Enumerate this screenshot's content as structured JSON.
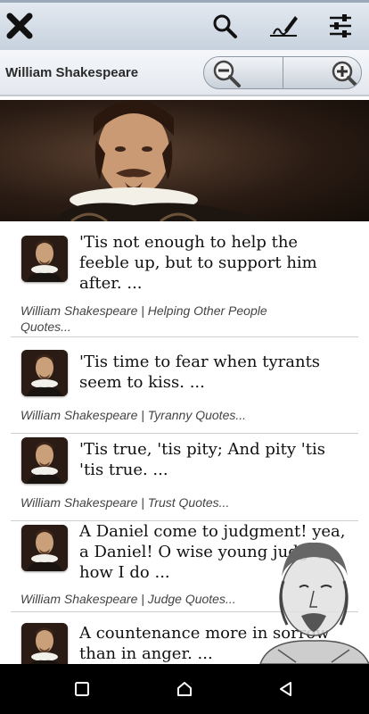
{
  "header": {
    "title": "William Shakespeare",
    "icons": [
      "close-icon",
      "search-icon",
      "sign-pen-icon",
      "settings-sliders-icon"
    ],
    "zoom": [
      "zoom-out-icon",
      "zoom-in-icon"
    ]
  },
  "banner": {
    "description_icon": "portrait-image"
  },
  "quotes": [
    {
      "text": "'Tis not enough to help the feeble up, but to support him after. ...",
      "source": "William Shakespeare | Helping Other People Quotes..."
    },
    {
      "text": "'Tis time to fear when tyrants seem to kiss. ...",
      "source": "William Shakespeare | Tyranny Quotes..."
    },
    {
      "text": "'Tis true, 'tis pity; And pity 'tis 'tis true. ...",
      "source": "William Shakespeare | Trust Quotes..."
    },
    {
      "text": "A Daniel come to judgment! yea, a Daniel! O wise young judge, how I do ...",
      "source": "William Shakespeare | Judge Quotes..."
    },
    {
      "text": "A countenance more in sorrow than in anger. ...",
      "source": ""
    }
  ],
  "navbar": {
    "icons": [
      "recent-apps-icon",
      "home-icon",
      "back-icon"
    ]
  },
  "colors": {
    "toolbar": "#c7d2de",
    "navbar": "#000000",
    "quote_text": "#111111",
    "source_text": "#444444"
  }
}
